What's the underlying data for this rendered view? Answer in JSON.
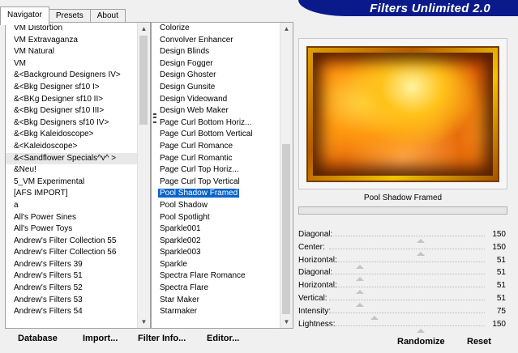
{
  "tabs": [
    "Navigator",
    "Presets",
    "About"
  ],
  "banner_title": "Filters Unlimited 2.0",
  "categories": [
    "VM Distortion",
    "VM Extravaganza",
    "VM Natural",
    "VM",
    "&<Background Designers IV>",
    "&<Bkg Designer sf10 I>",
    "&<BKg Designer sf10 II>",
    "&<Bkg Designer sf10 III>",
    "&<Bkg Designers sf10 IV>",
    "&<Bkg Kaleidoscope>",
    "&<Kaleidoscope>",
    "&<Sandflower Specials^v^ >",
    "&Neu!",
    "5_VM Experimental",
    "[AFS IMPORT]",
    "a",
    "All's Power Sines",
    "All's Power Toys",
    "Andrew's Filter Collection 55",
    "Andrew's Filter Collection 56",
    "Andrew's Filters 39",
    "Andrew's Filters 51",
    "Andrew's Filters 52",
    "Andrew's Filters 53",
    "Andrew's Filters 54"
  ],
  "filters": [
    "Colorize",
    "Convolver Enhancer",
    "Design Blinds",
    "Design Fogger",
    "Design Ghoster",
    "Design Gunsite",
    "Design Videowand",
    "Design Web Maker",
    "Page Curl Bottom Horiz...",
    "Page Curl Bottom Vertical",
    "Page Curl Romance",
    "Page Curl Romantic",
    "Page Curl Top Horiz...",
    "Page Curl Top Vertical",
    "Pool Shadow Framed",
    "Pool Shadow",
    "Pool Spotlight",
    "Sparkle001",
    "Sparkle002",
    "Sparkle003",
    "Sparkle",
    "Spectra Flare Romance",
    "Spectra Flare",
    "Star Maker",
    "Starmaker"
  ],
  "selected_filter_index": 14,
  "highlighted_category_index": 11,
  "preview_title": "Pool Shadow Framed",
  "params": [
    {
      "label": "Diagonal:",
      "value": "150",
      "level": 0.59
    },
    {
      "label": "Center:",
      "value": "150",
      "level": 0.59
    },
    {
      "label": "Horizontal:",
      "value": "51",
      "level": 0.2
    },
    {
      "label": "Diagonal:",
      "value": "51",
      "level": 0.2
    },
    {
      "label": "Horizontal:",
      "value": "51",
      "level": 0.2
    },
    {
      "label": "Vertical:",
      "value": "51",
      "level": 0.2
    },
    {
      "label": "Intensity:",
      "value": "75",
      "level": 0.29
    },
    {
      "label": "Lightness:",
      "value": "150",
      "level": 0.59
    }
  ],
  "buttons": {
    "database": "Database",
    "import": "Import...",
    "filter_info": "Filter Info...",
    "editor": "Editor...",
    "randomize": "Randomize",
    "reset": "Reset"
  },
  "colors": {
    "selection": "#0a64c8",
    "banner": "#0a1a8a"
  }
}
